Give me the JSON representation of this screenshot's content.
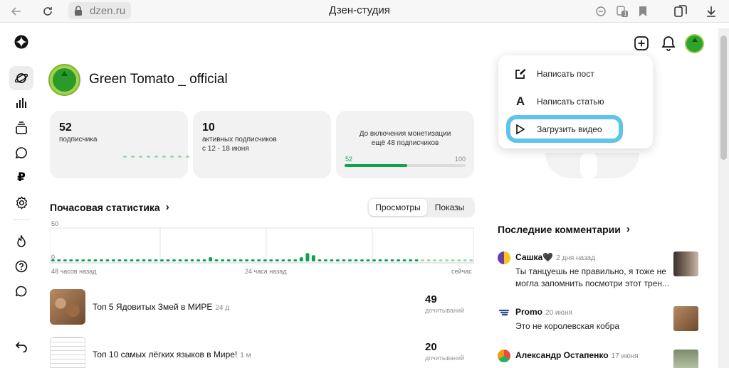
{
  "browser": {
    "url": "dzen.ru",
    "tab_title": "Дзен-студия",
    "reader_badge": "1"
  },
  "channel": {
    "name": "Green Tomato _ official"
  },
  "stats": {
    "subscribers": {
      "value": "52",
      "label": "подписчика"
    },
    "active": {
      "value": "10",
      "label1": "активных подписчиков",
      "label2": "с 12 - 18 июня"
    },
    "monetization": {
      "line1": "До включения монетизации",
      "line2": "ещё 48 подписчиков",
      "current": "52",
      "target": "100",
      "progress": 0.52
    }
  },
  "hourly": {
    "title": "Почасовая статистика",
    "tabs": {
      "views": "Просмотры",
      "impressions": "Показы"
    },
    "y_max_label": "50",
    "y_min_label": "0",
    "x_labels": {
      "start": "48 часов назад",
      "mid": "24 часа назад",
      "end": "сейчас"
    }
  },
  "chart_data": {
    "type": "bar",
    "title": "Почасовая статистика",
    "ylim": [
      0,
      50
    ],
    "x_labels": [
      "48 часов назад",
      "24 часа назад",
      "сейчас"
    ],
    "values": [
      1,
      1,
      1,
      1,
      1,
      1,
      1,
      1,
      1,
      1,
      1,
      1,
      1,
      1,
      1,
      1,
      1,
      1,
      1,
      1,
      1,
      1,
      1,
      1,
      1,
      1,
      2,
      1,
      1,
      1,
      1,
      1,
      1,
      1,
      1,
      1,
      1,
      1,
      1,
      1,
      1,
      2,
      4,
      3,
      1,
      1,
      1,
      1,
      1,
      1,
      1,
      1,
      1,
      1,
      1,
      1,
      1,
      1,
      1,
      1,
      1,
      1,
      1,
      1,
      1,
      1,
      1,
      1,
      1,
      1
    ]
  },
  "videos": [
    {
      "title": "Топ 5 Ядовитых Змей в МИРЕ",
      "age": "24 д",
      "value": "49",
      "label": "дочитываний"
    },
    {
      "title": "Топ 10 самых лёгких языков в Мире!",
      "age": "1 м",
      "value": "20",
      "label": "дочитываний"
    }
  ],
  "menu": {
    "items": [
      {
        "label": "Написать пост"
      },
      {
        "label": "Написать статью"
      },
      {
        "label": "Загрузить видео"
      }
    ]
  },
  "comments": {
    "title": "Последние комментарии",
    "items": [
      {
        "author": "Сашка🖤",
        "date": "2 дня назад",
        "text": "Ты танцуешь не правильно, я тоже не могла запомнить посмотри этот трен..."
      },
      {
        "author": "Promo",
        "date": "20 июня",
        "text": "Это не королевская кобра"
      },
      {
        "author": "Александр Остапенко",
        "date": "17 июня",
        "text": ""
      }
    ]
  },
  "colors": {
    "accent_green": "#12a150",
    "highlight_blue": "#5fc3ea",
    "card_bg": "#f2f2f2"
  }
}
